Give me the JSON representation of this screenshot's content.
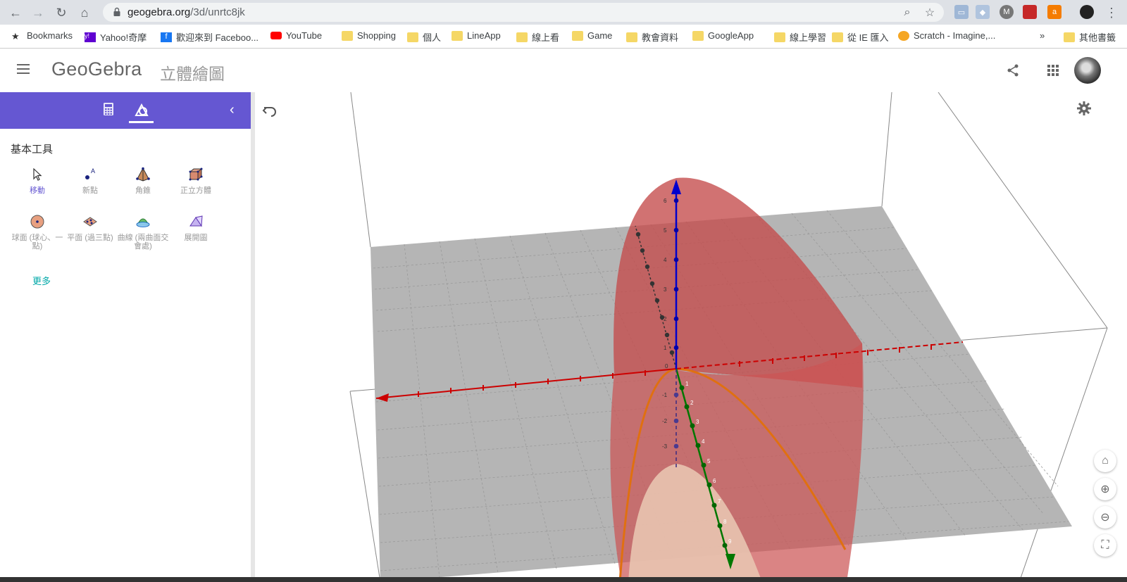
{
  "browser": {
    "url_host": "geogebra.org",
    "url_path": "/3d/unrtc8jk",
    "bookmarks": [
      {
        "label": "Bookmarks",
        "icon": "star-icon"
      },
      {
        "label": "Yahoo!奇摩",
        "icon": "yahoo-icon"
      },
      {
        "label": "歡迎來到 Faceboo...",
        "icon": "facebook-icon"
      },
      {
        "label": "YouTube",
        "icon": "youtube-icon"
      },
      {
        "label": "Shopping",
        "icon": "folder-icon"
      },
      {
        "label": "個人",
        "icon": "folder-icon"
      },
      {
        "label": "LineApp",
        "icon": "folder-icon"
      },
      {
        "label": "線上看",
        "icon": "folder-icon"
      },
      {
        "label": "Game",
        "icon": "folder-icon"
      },
      {
        "label": "教會資料",
        "icon": "folder-icon"
      },
      {
        "label": "GoogleApp",
        "icon": "folder-icon"
      },
      {
        "label": "線上學習",
        "icon": "folder-icon"
      },
      {
        "label": "從 IE 匯入",
        "icon": "folder-icon"
      },
      {
        "label": "Scratch - Imagine,...",
        "icon": "scratch-icon"
      }
    ],
    "overflow_label": "»",
    "other_bookmarks": "其他書籤"
  },
  "app": {
    "brand": "GeoGebra",
    "title": "立體繪圖"
  },
  "tools": {
    "heading": "基本工具",
    "items": [
      {
        "label": "移動",
        "icon": "move-arrow-icon",
        "active": true
      },
      {
        "label": "新點",
        "icon": "new-point-icon"
      },
      {
        "label": "角錐",
        "icon": "pyramid-icon"
      },
      {
        "label": "正立方體",
        "icon": "cube-icon"
      },
      {
        "label": "球面 (球心、一點)",
        "icon": "sphere-icon"
      },
      {
        "label": "平面 (過三點)",
        "icon": "plane-icon"
      },
      {
        "label": "曲線 (兩曲面交會處)",
        "icon": "intersect-icon"
      },
      {
        "label": "展開圖",
        "icon": "net-icon"
      }
    ],
    "more": "更多"
  },
  "axes": {
    "z_ticks": [
      "6",
      "5",
      "4",
      "3",
      "2",
      "1",
      "0",
      "-1",
      "-2",
      "-3"
    ],
    "y_ticks": [
      "1",
      "2",
      "3",
      "4",
      "5",
      "6",
      "7",
      "8",
      "9"
    ]
  },
  "colors": {
    "accent": "#6557d2",
    "surface": "#c44a4a",
    "x_axis": "#cc0000",
    "y_axis": "#007700",
    "z_axis": "#0000cc",
    "curve": "#e07010"
  }
}
